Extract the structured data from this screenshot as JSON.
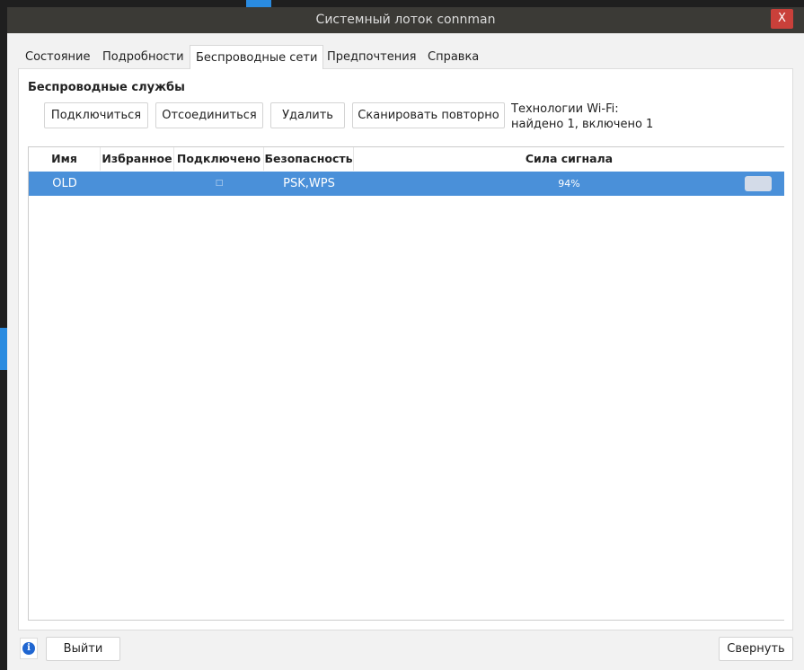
{
  "window": {
    "title": "Системный лоток connman",
    "close_label": "X"
  },
  "tabs": [
    {
      "label": "Состояние"
    },
    {
      "label": "Подробности"
    },
    {
      "label": "Беспроводные сети",
      "active": true
    },
    {
      "label": "Предпочтения"
    },
    {
      "label": "Справка"
    }
  ],
  "wireless": {
    "group_title": "Беспроводные службы",
    "buttons": {
      "connect": "Подключиться",
      "disconnect": "Отсоединиться",
      "remove": "Удалить",
      "rescan": "Сканировать повторно"
    },
    "tech_line1": "Технологии Wi-Fi:",
    "tech_line2": "найдено 1, включено 1",
    "columns": [
      "Имя",
      "Избранное",
      "Подключено",
      "Безопасность",
      "Сила сигнала"
    ],
    "rows": [
      {
        "name": "OLD",
        "favorite": "",
        "connected_icon": "connected-icon",
        "security": "PSK,WPS",
        "signal": "94%",
        "signal_value": 94
      }
    ]
  },
  "footer": {
    "info_icon": "info-icon",
    "info_glyph": "i",
    "exit": "Выйти",
    "minimize": "Свернуть"
  },
  "colors": {
    "selection": "#4a90d9",
    "titlebar": "#3b3a36",
    "close": "#c9403a"
  }
}
